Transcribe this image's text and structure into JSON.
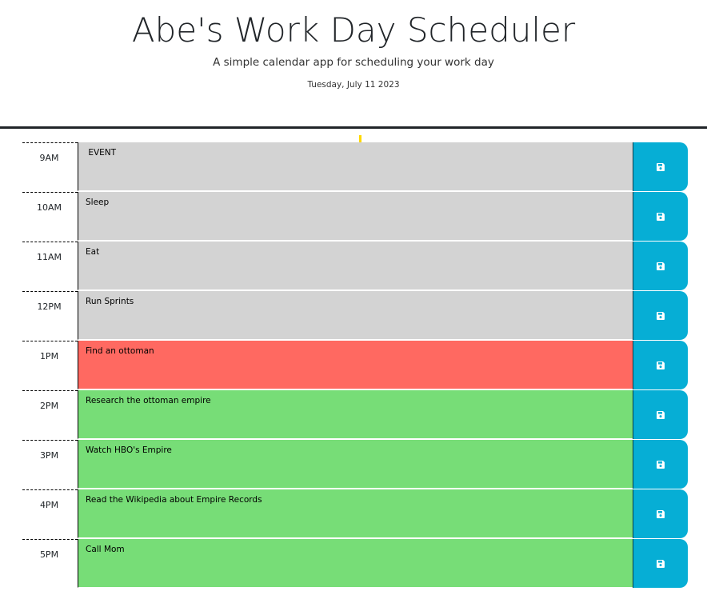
{
  "header": {
    "title": "Abe's Work Day Scheduler",
    "subtitle": "A simple calendar app for scheduling your work day",
    "current_day": "Tuesday, July 11 2023"
  },
  "colors": {
    "past": "#d3d3d3",
    "present": "#ff6961",
    "future": "#77dd77",
    "save_button": "#06aed5"
  },
  "time_blocks": [
    {
      "hour": "9AM",
      "text": " EVENT",
      "state": "past",
      "icon": "save-icon"
    },
    {
      "hour": "10AM",
      "text": "Sleep",
      "state": "past",
      "icon": "save-icon"
    },
    {
      "hour": "11AM",
      "text": "Eat",
      "state": "past",
      "icon": "save-icon"
    },
    {
      "hour": "12PM",
      "text": "Run Sprints",
      "state": "past",
      "icon": "save-icon"
    },
    {
      "hour": "1PM",
      "text": "Find an ottoman",
      "state": "present",
      "icon": "save-icon"
    },
    {
      "hour": "2PM",
      "text": "Research the ottoman empire",
      "state": "future",
      "icon": "save-icon"
    },
    {
      "hour": "3PM",
      "text": "Watch HBO's Empire",
      "state": "future",
      "icon": "save-icon"
    },
    {
      "hour": "4PM",
      "text": "Read the Wikipedia about Empire Records",
      "state": "future",
      "icon": "save-icon"
    },
    {
      "hour": "5PM",
      "text": "Call Mom",
      "state": "future",
      "icon": "save-icon"
    }
  ]
}
